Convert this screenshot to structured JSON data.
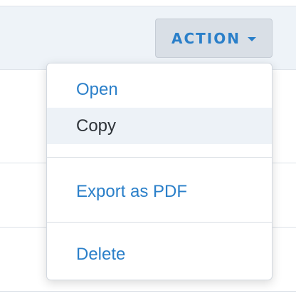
{
  "toolbar": {
    "action_label": "ACTION"
  },
  "menu": {
    "items": [
      {
        "label": "Open"
      },
      {
        "label": "Copy"
      },
      {
        "label": "Export as PDF"
      },
      {
        "label": "Delete"
      }
    ]
  },
  "colors": {
    "accent": "#2a7fc9",
    "header_bg": "#eef3f8",
    "button_bg": "#d9dfe6",
    "active_item_bg": "#edf2f7"
  }
}
